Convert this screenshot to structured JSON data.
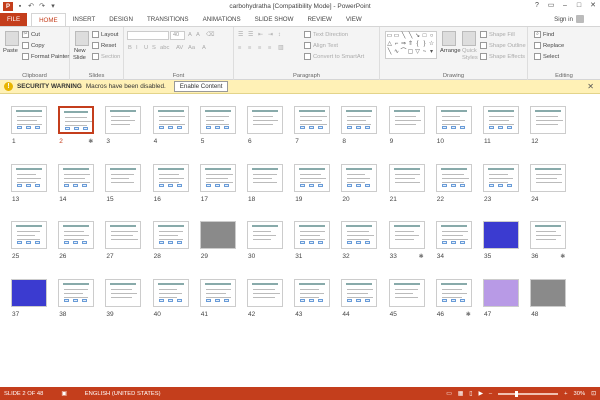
{
  "window": {
    "title": "carbohydratha [Compatibility Mode] - PowerPoint",
    "app_icon": "P"
  },
  "tabs": [
    "FILE",
    "HOME",
    "INSERT",
    "DESIGN",
    "TRANSITIONS",
    "ANIMATIONS",
    "SLIDE SHOW",
    "REVIEW",
    "VIEW"
  ],
  "active_tab": "HOME",
  "signin": "Sign in",
  "ribbon": {
    "clipboard": {
      "paste": "Paste",
      "cut": "Cut",
      "copy": "Copy",
      "format_painter": "Format Painter",
      "label": "Clipboard"
    },
    "slides": {
      "new_slide": "New",
      "new_slide2": "Slide",
      "layout": "Layout",
      "reset": "Reset",
      "section": "Section",
      "label": "Slides"
    },
    "font": {
      "size": "40",
      "label": "Font"
    },
    "paragraph": {
      "text_direction": "Text Direction",
      "align_text": "Align Text",
      "convert": "Convert to SmartArt",
      "label": "Paragraph"
    },
    "drawing": {
      "arrange": "Arrange",
      "quick_styles": "Quick",
      "quick_styles2": "Styles",
      "shape_fill": "Shape Fill",
      "shape_outline": "Shape Outline",
      "shape_effects": "Shape Effects",
      "label": "Drawing"
    },
    "editing": {
      "find": "Find",
      "replace": "Replace",
      "select": "Select",
      "label": "Editing"
    }
  },
  "security": {
    "title": "SECURITY WARNING",
    "message": "Macros have been disabled.",
    "button": "Enable Content"
  },
  "slides": {
    "numbers": [
      "1",
      "2",
      "3",
      "4",
      "5",
      "6",
      "7",
      "8",
      "9",
      "10",
      "11",
      "12",
      "13",
      "14",
      "15",
      "16",
      "17",
      "18",
      "19",
      "20",
      "21",
      "22",
      "23",
      "24",
      "25",
      "26",
      "27",
      "28",
      "29",
      "30",
      "31",
      "32",
      "33",
      "34",
      "35",
      "36",
      "37",
      "38",
      "39",
      "40",
      "41",
      "42",
      "43",
      "44",
      "45",
      "46",
      "47",
      "48"
    ],
    "selected": 2,
    "starred": [
      2,
      33,
      36,
      46
    ],
    "special": {
      "1": "food",
      "35": "blue",
      "37": "blue",
      "47": "purple",
      "48": "photo",
      "29": "photo"
    }
  },
  "status": {
    "slide": "SLIDE 2 OF 48",
    "language": "ENGLISH (UNITED STATES)",
    "zoom": "30%",
    "zoom_level": 0.3
  }
}
